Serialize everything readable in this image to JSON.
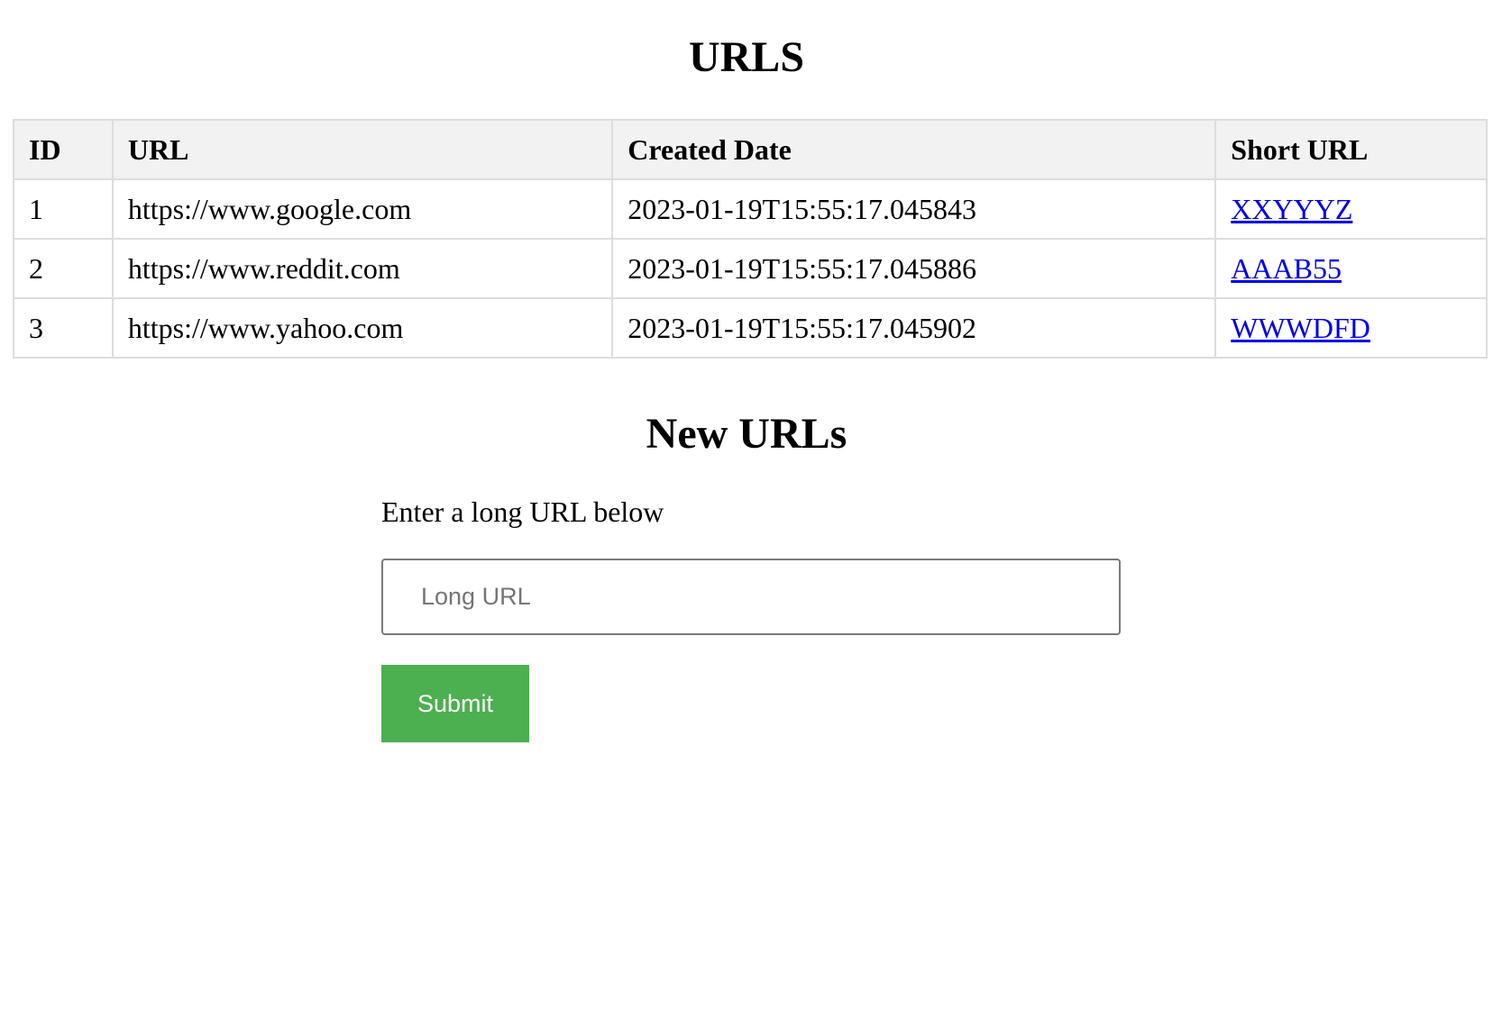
{
  "urls_section": {
    "title": "URLS",
    "table": {
      "headers": [
        "ID",
        "URL",
        "Created Date",
        "Short URL"
      ],
      "rows": [
        {
          "id": "1",
          "url": "https://www.google.com",
          "created": "2023-01-19T15:55:17.045843",
          "short": "XXYYYZ"
        },
        {
          "id": "2",
          "url": "https://www.reddit.com",
          "created": "2023-01-19T15:55:17.045886",
          "short": "AAAB55"
        },
        {
          "id": "3",
          "url": "https://www.yahoo.com",
          "created": "2023-01-19T15:55:17.045902",
          "short": "WWWDFD"
        }
      ]
    }
  },
  "new_section": {
    "title": "New URLs",
    "label": "Enter a long URL below",
    "input_value": "",
    "input_placeholder": "Long URL",
    "submit_label": "Submit"
  },
  "colors": {
    "submit_bg": "#4caf50",
    "link": "#0000ee",
    "header_bg": "#f2f2f2",
    "border": "#dddddd"
  }
}
